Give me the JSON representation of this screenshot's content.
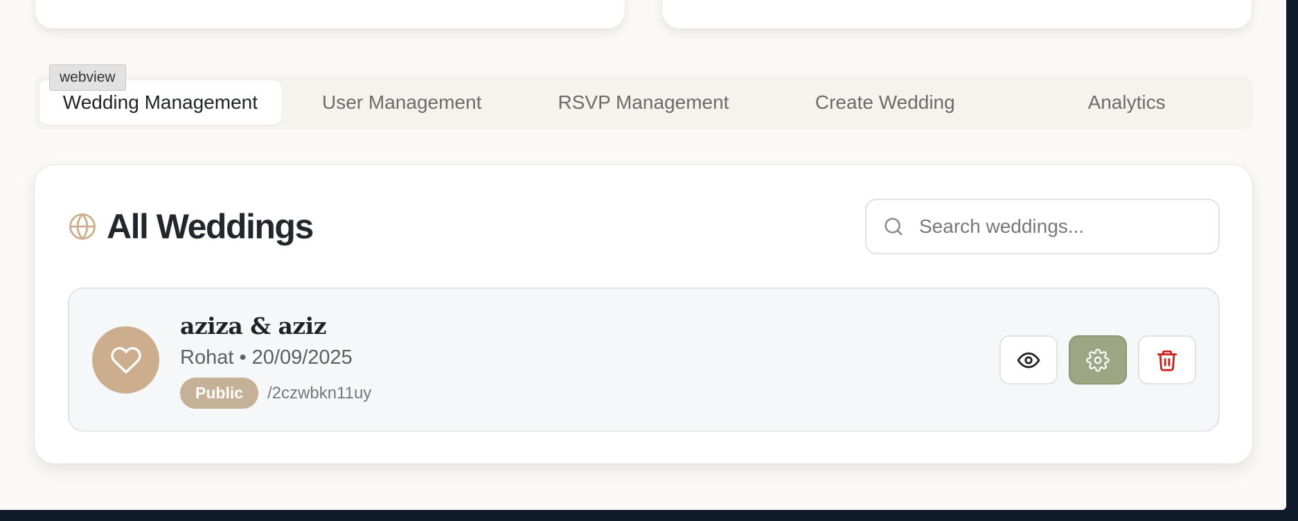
{
  "tabs": {
    "webview_label": "webview",
    "items": [
      {
        "label": "Wedding Management",
        "active": true
      },
      {
        "label": "User Management",
        "active": false
      },
      {
        "label": "RSVP Management",
        "active": false
      },
      {
        "label": "Create Wedding",
        "active": false
      },
      {
        "label": "Analytics",
        "active": false
      }
    ]
  },
  "panel": {
    "title": "All Weddings",
    "title_icon": "globe-icon",
    "search": {
      "placeholder": "Search weddings...",
      "value": "",
      "icon": "search-icon"
    }
  },
  "weddings": [
    {
      "couple": "aziza & aziz",
      "meta": "Rohat • 20/09/2025",
      "visibility": "Public",
      "slug": "/2czwbkn11uy",
      "avatar_icon": "heart-icon",
      "actions": [
        "eye-icon",
        "gear-icon",
        "trash-icon"
      ]
    }
  ],
  "colors": {
    "accent": "#ccad8d",
    "badge": "#c4b197",
    "settings_button": "#9da684",
    "delete_icon": "#c8211b",
    "page_background": "#faf9f8",
    "outer_background": "#0f1a2b"
  }
}
